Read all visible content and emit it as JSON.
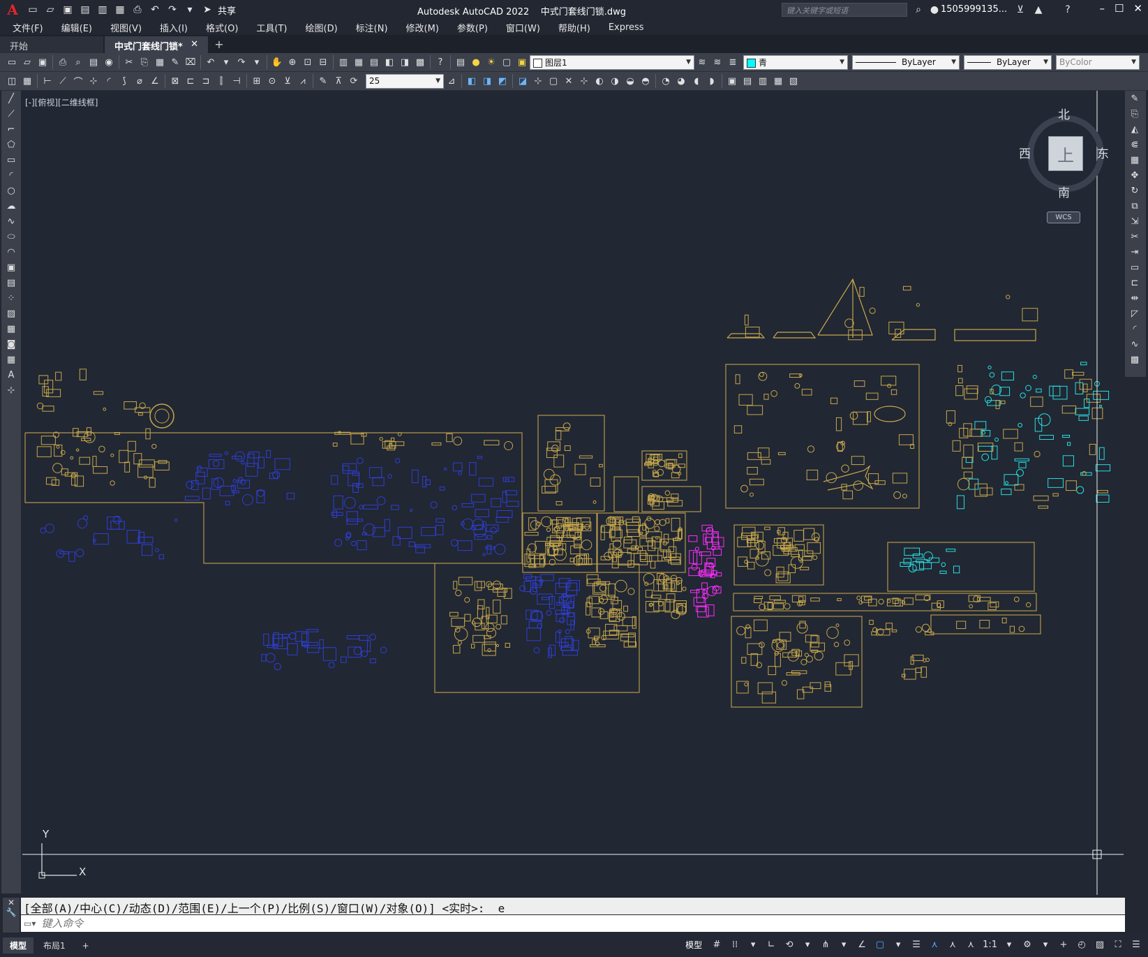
{
  "titlebar": {
    "app_name": "Autodesk AutoCAD 2022",
    "file_name": "中式门套线门锁.dwg",
    "share_label": "共享",
    "search_placeholder": "键入关键字或短语",
    "user_name": "1505999135..."
  },
  "menubar": {
    "items": [
      "文件(F)",
      "编辑(E)",
      "视图(V)",
      "插入(I)",
      "格式(O)",
      "工具(T)",
      "绘图(D)",
      "标注(N)",
      "修改(M)",
      "参数(P)",
      "窗口(W)",
      "帮助(H)",
      "Express"
    ]
  },
  "tabs": {
    "start": "开始",
    "active": "中式门套线门锁*"
  },
  "toolbar1": {
    "layer": "图层1",
    "color": "青",
    "color_hex": "#00ffff",
    "linetype": "ByLayer",
    "lineweight": "ByLayer",
    "plotstyle": "ByColor"
  },
  "toolbar2": {
    "dim_value": "25"
  },
  "canvas": {
    "view_label": "[-][俯视][二维线框]",
    "viewcube": {
      "north": "北",
      "south": "南",
      "east": "东",
      "west": "西",
      "face": "上"
    },
    "wcs": "WCS",
    "ucs": {
      "x": "X",
      "y": "Y"
    },
    "colors": {
      "yellow": "#c8a84b",
      "blue": "#2f3fd6",
      "cyan": "#28e0e0",
      "magenta": "#ff2cff"
    }
  },
  "command": {
    "history": "[全部(A)/中心(C)/动态(D)/范围(E)/上一个(P)/比例(S)/窗口(W)/对象(O)] <实时>: _e",
    "placeholder": "键入命令"
  },
  "statusbar": {
    "tabs": [
      "模型",
      "布局1"
    ],
    "model_label": "模型",
    "scale": "1:1"
  }
}
